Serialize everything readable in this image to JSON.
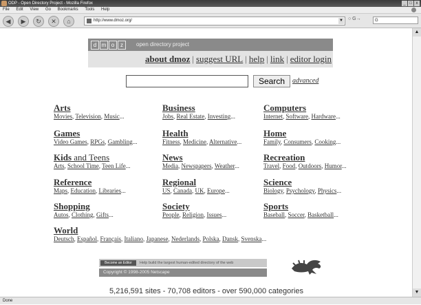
{
  "window": {
    "title": "ODP - Open Directory Project - Mozilla Firefox",
    "controls": [
      "_",
      "□",
      "x"
    ]
  },
  "menu": [
    "File",
    "Edit",
    "View",
    "Go",
    "Bookmarks",
    "Tools",
    "Help"
  ],
  "toolbar": {
    "url": "http://www.dmoz.org/",
    "go_label": "○ G→",
    "search_placeholder": "G"
  },
  "header": {
    "logo_letters": [
      "d",
      "m",
      "o",
      "z"
    ],
    "tagline": "open directory project",
    "links": {
      "about": "about dmoz",
      "suggest": "suggest URL",
      "help": "help",
      "link": "link",
      "editor": "editor login"
    }
  },
  "search": {
    "value": "",
    "button_label": "Search",
    "advanced_label": "advanced"
  },
  "categories": [
    {
      "title": "Arts",
      "title_plain": "",
      "subs": [
        "Movies",
        "Television",
        "Music"
      ]
    },
    {
      "title": "Business",
      "title_plain": "",
      "subs": [
        "Jobs",
        "Real Estate",
        "Investing"
      ]
    },
    {
      "title": "Computers",
      "title_plain": "",
      "subs": [
        "Internet",
        "Software",
        "Hardware"
      ]
    },
    {
      "title": "Games",
      "title_plain": "",
      "subs": [
        "Video Games",
        "RPGs",
        "Gambling"
      ]
    },
    {
      "title": "Health",
      "title_plain": "",
      "subs": [
        "Fitness",
        "Medicine",
        "Alternative"
      ]
    },
    {
      "title": "Home",
      "title_plain": "",
      "subs": [
        "Family",
        "Consumers",
        "Cooking"
      ]
    },
    {
      "title": "Kids",
      "title_plain": " and Teens",
      "subs": [
        "Arts",
        "School Time",
        "Teen Life"
      ]
    },
    {
      "title": "News",
      "title_plain": "",
      "subs": [
        "Media",
        "Newspapers",
        "Weather"
      ]
    },
    {
      "title": "Recreation",
      "title_plain": "",
      "subs": [
        "Travel",
        "Food",
        "Outdoors",
        "Humor"
      ]
    },
    {
      "title": "Reference",
      "title_plain": "",
      "subs": [
        "Maps",
        "Education",
        "Libraries"
      ]
    },
    {
      "title": "Regional",
      "title_plain": "",
      "subs": [
        "US",
        "Canada",
        "UK",
        "Europe"
      ]
    },
    {
      "title": "Science",
      "title_plain": "",
      "subs": [
        "Biology",
        "Psychology",
        "Physics"
      ]
    },
    {
      "title": "Shopping",
      "title_plain": "",
      "subs": [
        "Autos",
        "Clothing",
        "Gifts"
      ]
    },
    {
      "title": "Society",
      "title_plain": "",
      "subs": [
        "People",
        "Religion",
        "Issues"
      ]
    },
    {
      "title": "Sports",
      "title_plain": "",
      "subs": [
        "Baseball",
        "Soccer",
        "Basketball"
      ]
    }
  ],
  "world": {
    "title": "World",
    "subs": [
      "Deutsch",
      "Español",
      "Français",
      "Italiano",
      "Japanese",
      "Nederlands",
      "Polska",
      "Dansk",
      "Svenska"
    ]
  },
  "footer": {
    "become_editor": "Become an Editor",
    "help_text": "Help build the largest human-edited directory of the web",
    "copyright": "Copyright © 1998-2005 Netscape"
  },
  "stats": "5,216,591 sites - 70,708 editors - over 590,000 categories",
  "status": "Done"
}
